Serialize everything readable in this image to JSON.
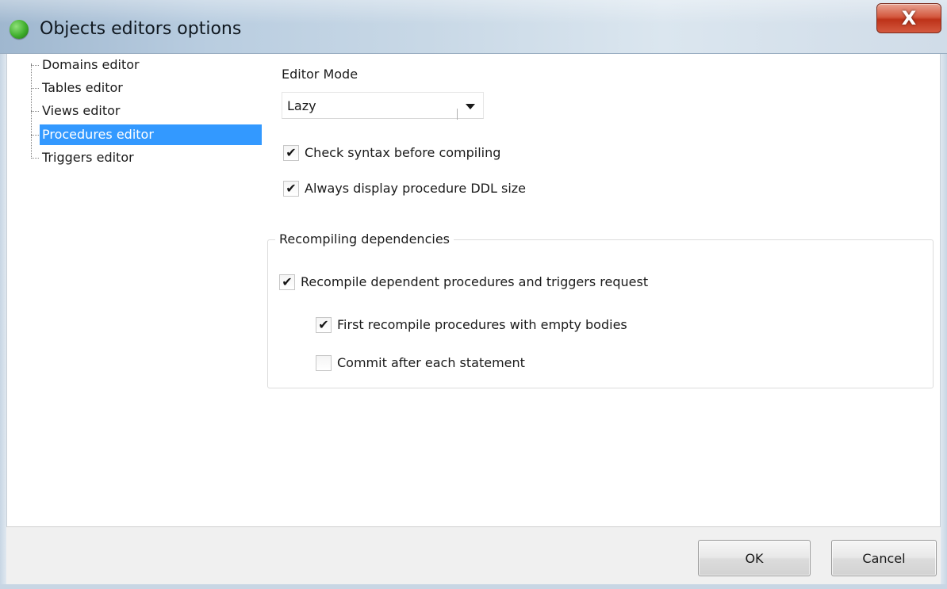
{
  "window": {
    "title": "Objects editors options",
    "close_label": "X"
  },
  "tree": {
    "items": [
      {
        "label": "Domains editor",
        "selected": false
      },
      {
        "label": "Tables editor",
        "selected": false
      },
      {
        "label": "Views editor",
        "selected": false
      },
      {
        "label": "Procedures editor",
        "selected": true
      },
      {
        "label": "Triggers editor",
        "selected": false
      }
    ]
  },
  "panel": {
    "editor_mode_label": "Editor Mode",
    "editor_mode_value": "Lazy",
    "check_syntax": {
      "label": "Check syntax before compiling",
      "checked": true
    },
    "always_display_ddl": {
      "label": "Always display procedure DDL size",
      "checked": true
    },
    "group_title": "Recompiling dependencies",
    "recompile_dependent": {
      "label": "Recompile dependent procedures and triggers request",
      "checked": true
    },
    "first_recompile_empty": {
      "label": "First recompile procedures with empty bodies",
      "checked": true
    },
    "commit_each": {
      "label": "Commit after each statement",
      "checked": false
    }
  },
  "footer": {
    "ok_label": "OK",
    "cancel_label": "Cancel"
  },
  "colors": {
    "selection": "#3399ff",
    "close_button": "#c73e23"
  }
}
